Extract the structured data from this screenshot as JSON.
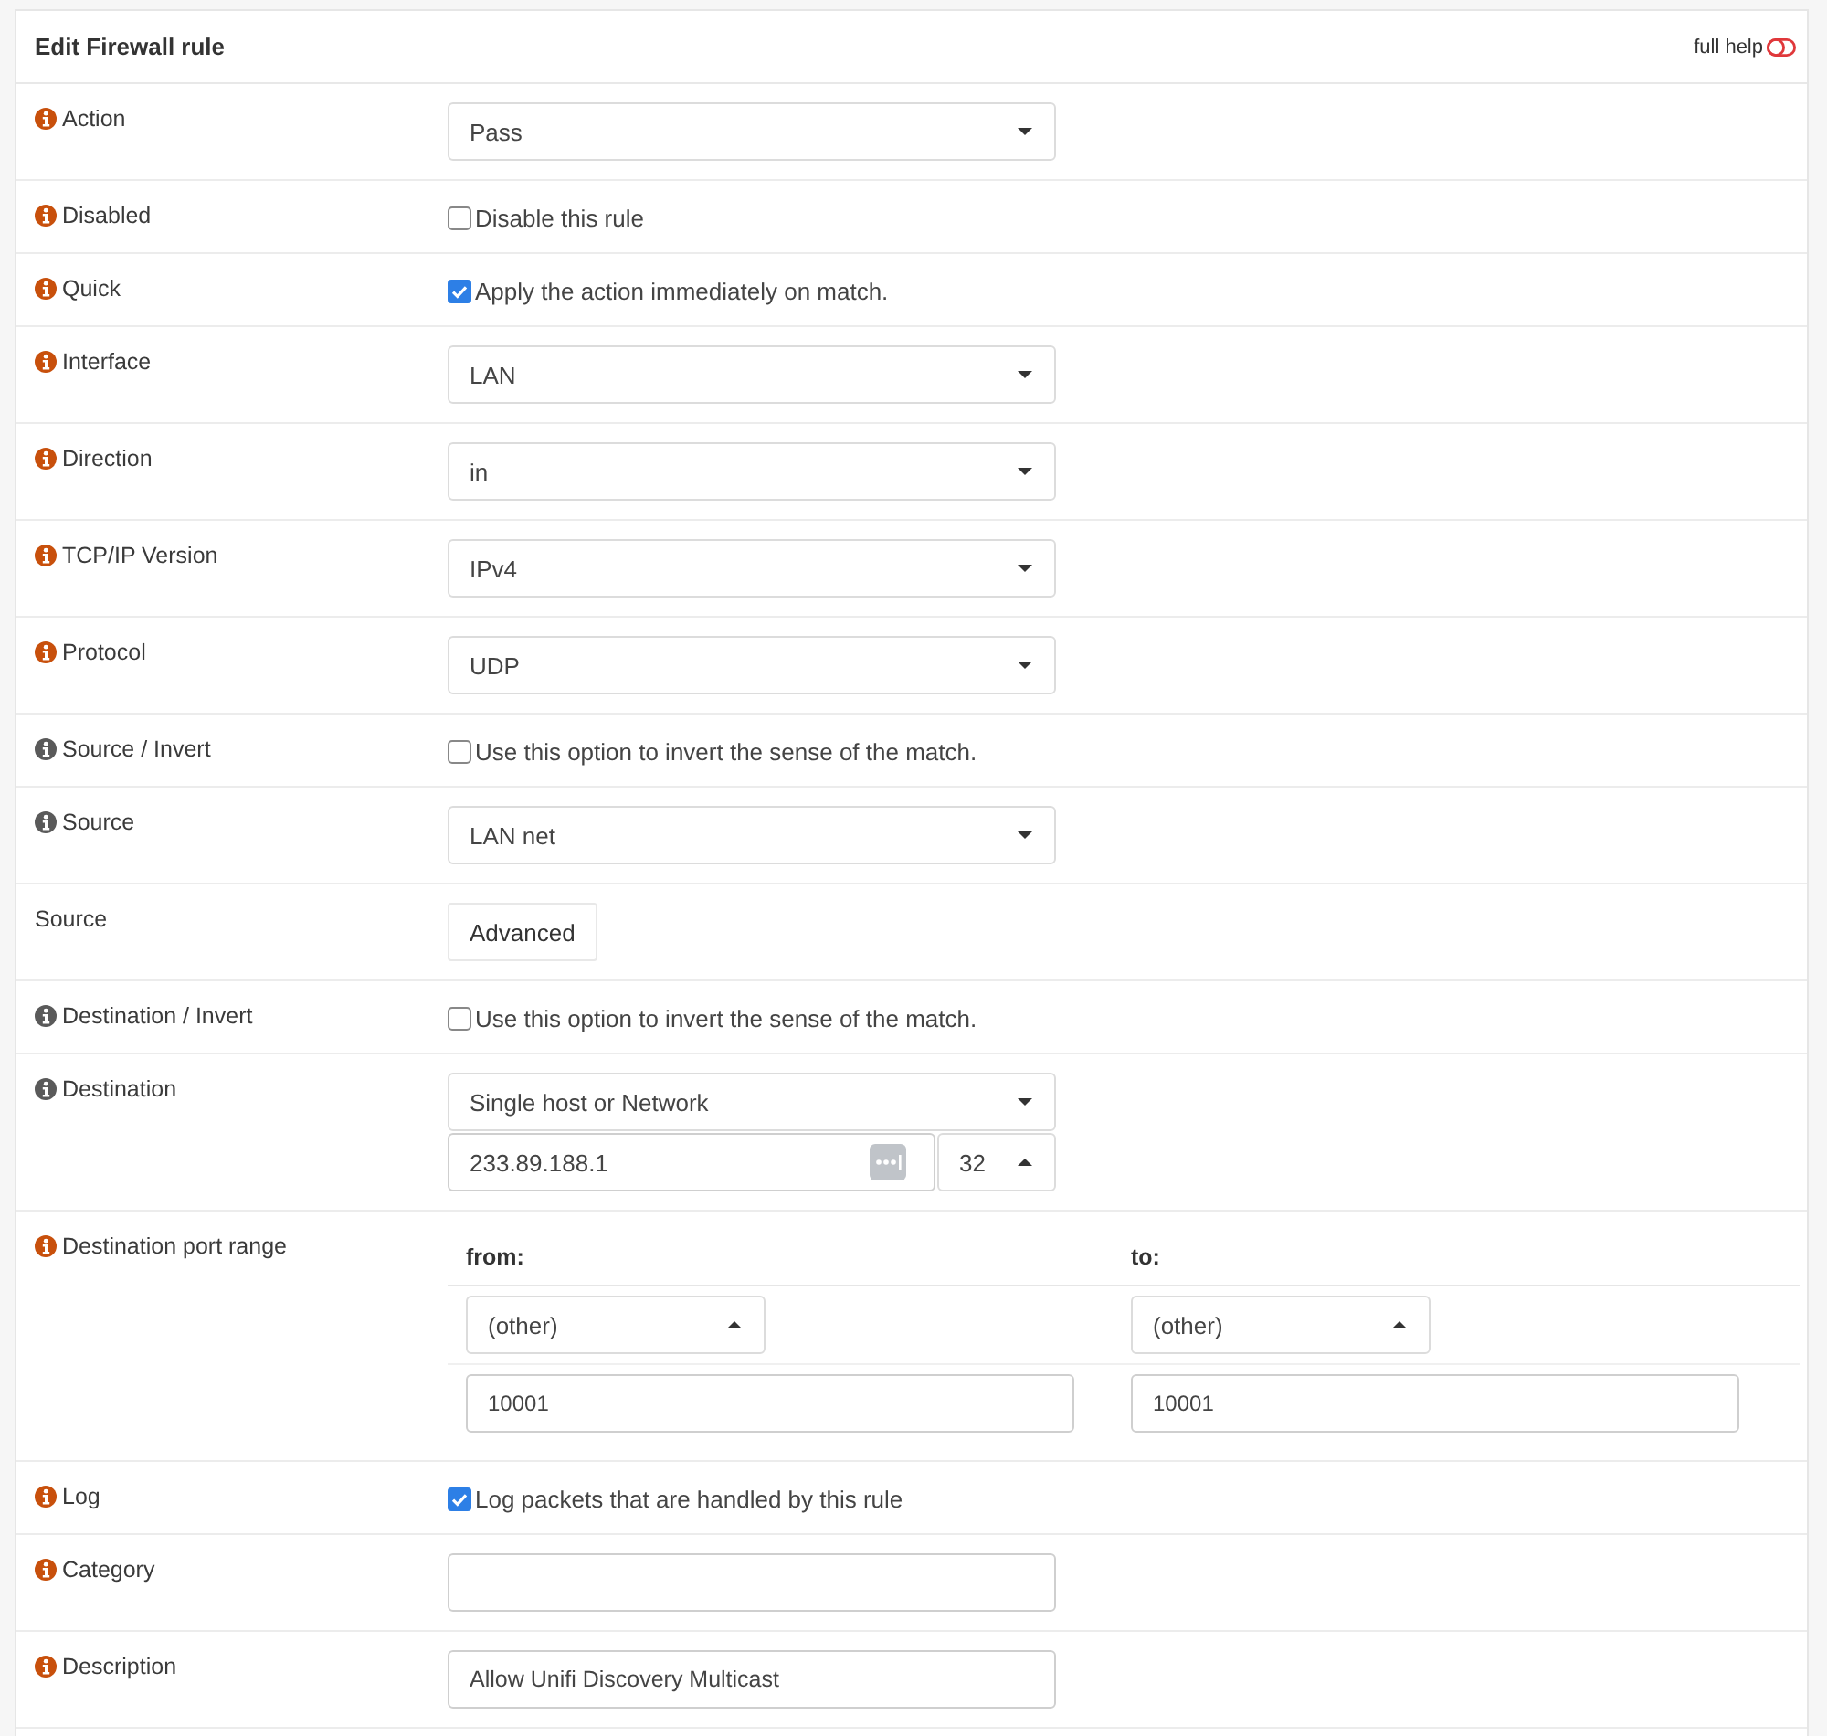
{
  "panel": {
    "title": "Edit Firewall rule",
    "full_help": {
      "label": "full help",
      "on": false
    }
  },
  "rows": [
    {
      "label": "Action",
      "color": "#c8500c",
      "kind": "select",
      "value": "Pass",
      "dropup": false
    },
    {
      "label": "Disabled",
      "color": "#c8500c",
      "kind": "checkbox",
      "checked": false,
      "text": "Disable this rule"
    },
    {
      "label": "Quick",
      "color": "#c8500c",
      "kind": "checkbox",
      "checked": true,
      "text": "Apply the action immediately on match."
    },
    {
      "label": "Interface",
      "color": "#c8500c",
      "kind": "select",
      "value": "LAN",
      "dropup": false
    },
    {
      "label": "Direction",
      "color": "#c8500c",
      "kind": "select",
      "value": "in",
      "dropup": false
    },
    {
      "label": "TCP/IP Version",
      "color": "#c8500c",
      "kind": "select",
      "value": "IPv4",
      "dropup": false
    },
    {
      "label": "Protocol",
      "color": "#c8500c",
      "kind": "select",
      "value": "UDP",
      "dropup": false
    },
    {
      "label": "Source / Invert",
      "color": "#5a5a5a",
      "kind": "checkbox",
      "checked": false,
      "text": "Use this option to invert the sense of the match."
    },
    {
      "label": "Source",
      "color": "#5a5a5a",
      "kind": "select",
      "value": "LAN net",
      "dropup": false
    },
    {
      "label": "Source",
      "kind": "button",
      "text": "Advanced"
    },
    {
      "label": "Destination / Invert",
      "color": "#5a5a5a",
      "kind": "checkbox",
      "checked": false,
      "text": "Use this option to invert the sense of the match."
    },
    {
      "label": "Destination",
      "color": "#5a5a5a",
      "kind": "address",
      "select": {
        "value": "Single host or Network",
        "dropup": false
      },
      "address": "233.89.188.1",
      "mask": {
        "value": "32",
        "dropup": true
      }
    },
    {
      "label": "Destination port range",
      "color": "#c8500c",
      "kind": "port_range",
      "columns": [
        {
          "heading": "from:",
          "select": {
            "value": "(other)",
            "dropup": true
          },
          "port": "10001"
        },
        {
          "heading": "to:",
          "select": {
            "value": "(other)",
            "dropup": true
          },
          "port": "10001"
        }
      ]
    },
    {
      "label": "Log",
      "color": "#c8500c",
      "kind": "checkbox",
      "checked": true,
      "text": "Log packets that are handled by this rule"
    },
    {
      "label": "Category",
      "color": "#c8500c",
      "kind": "text"
    },
    {
      "label": "Description",
      "color": "#c8500c",
      "kind": "text",
      "value": "Allow Unifi Discovery Multicast"
    }
  ]
}
